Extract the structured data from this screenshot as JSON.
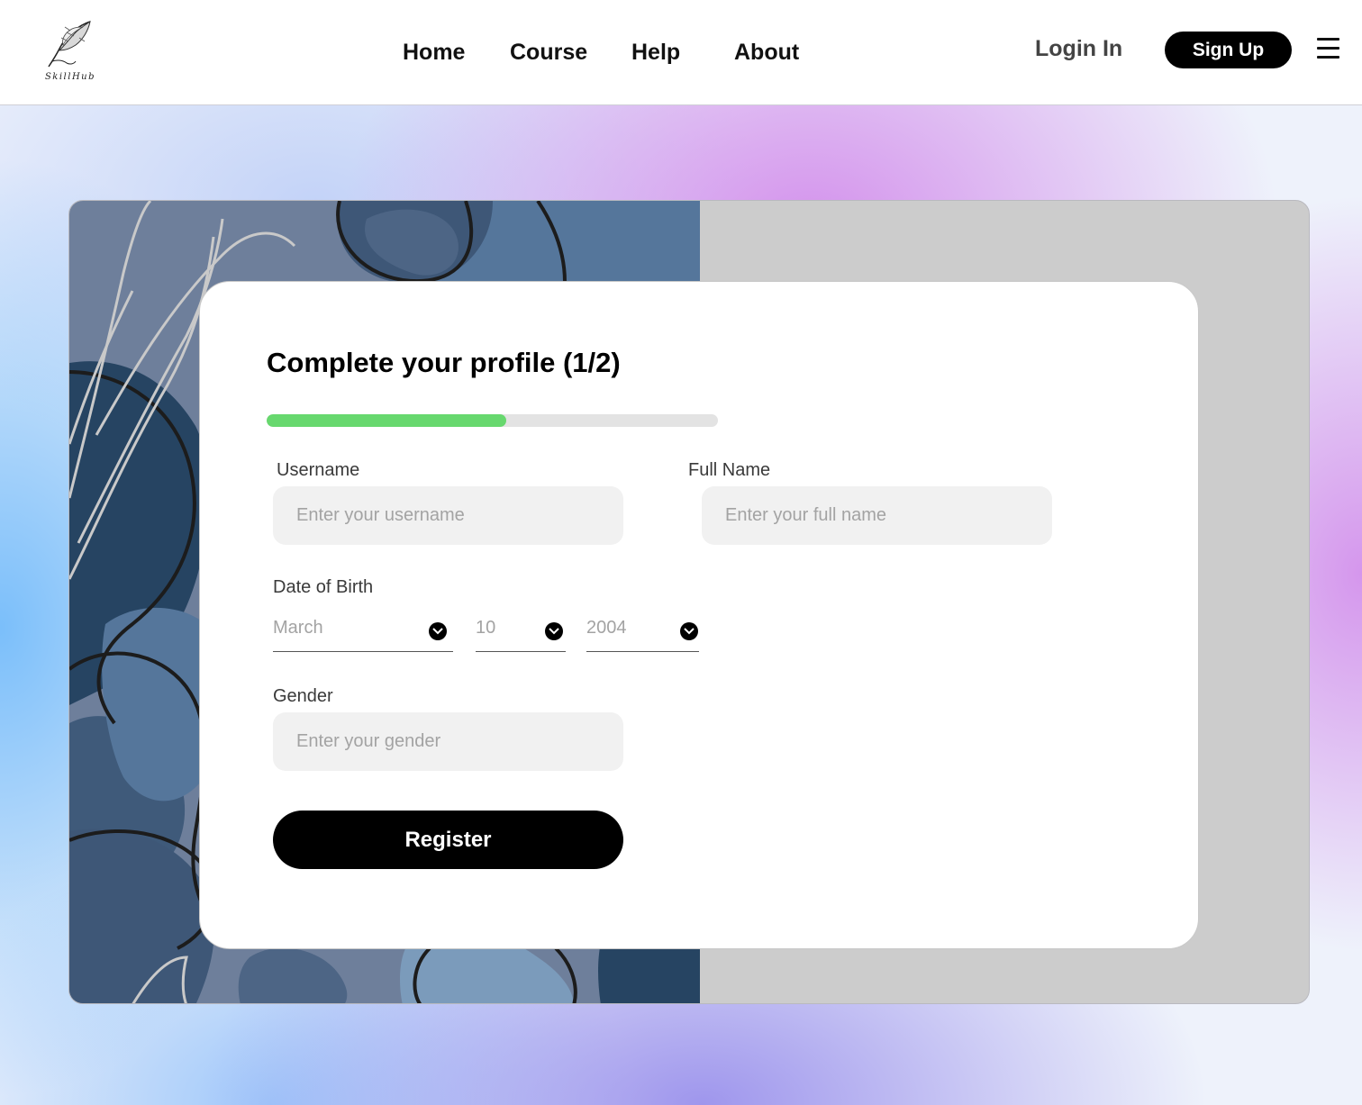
{
  "header": {
    "logo_text": "SkillHub",
    "nav": [
      {
        "label": "Home"
      },
      {
        "label": "Course"
      },
      {
        "label": "Help"
      },
      {
        "label": "About"
      }
    ],
    "login_label": "Login In",
    "signup_label": "Sign Up",
    "menu_icon": "hamburger-menu-icon"
  },
  "form": {
    "title": "Complete your profile (1/2)",
    "progress_fraction": 0.53,
    "username": {
      "label": "Username",
      "placeholder": "Enter your username",
      "value": ""
    },
    "full_name": {
      "label": "Full Name",
      "placeholder": "Enter your full name",
      "value": ""
    },
    "dob": {
      "label": "Date of Birth",
      "month": "March",
      "day": "10",
      "year": "2004",
      "chevron_icon": "chevron-down-icon"
    },
    "gender": {
      "label": "Gender",
      "placeholder": "Enter your gender",
      "value": ""
    },
    "register_label": "Register"
  },
  "colors": {
    "accent": "#000000",
    "progress": "#67d86e",
    "progress_track": "#e3e3e3",
    "input_bg": "#f1f1f1",
    "panel_right": "#cccccc"
  }
}
